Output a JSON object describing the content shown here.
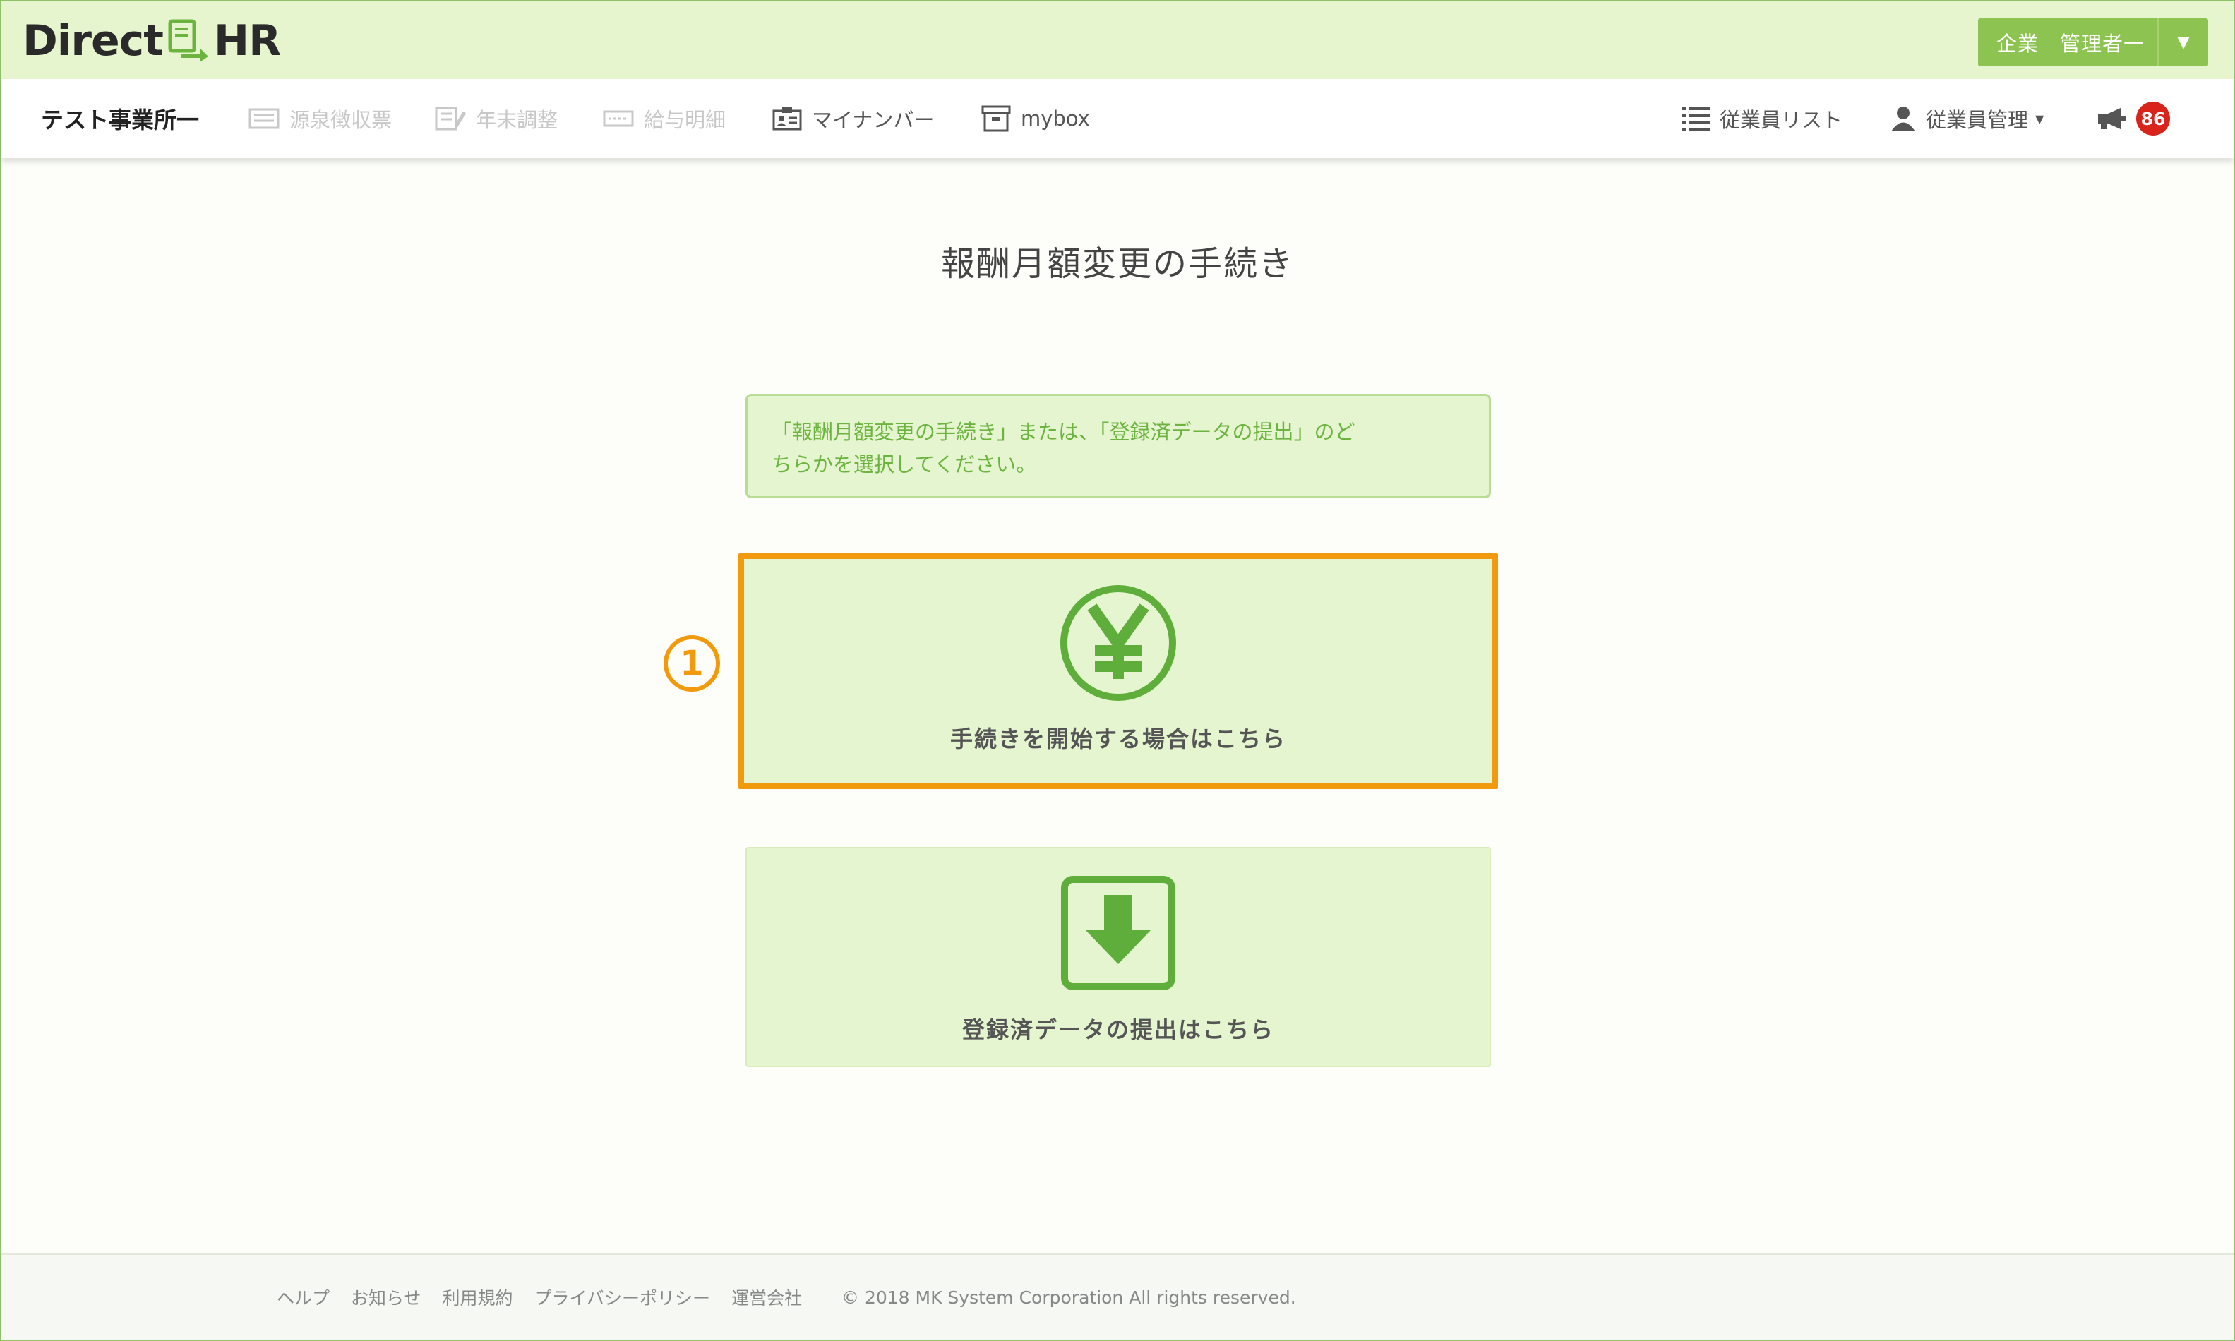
{
  "header": {
    "logo_left": "Direct",
    "logo_right": "HR",
    "admin_label": "企業　管理者一"
  },
  "nav": {
    "office_name": "テスト事業所一",
    "items": [
      {
        "label": "源泉徴収票",
        "icon": "receipt-icon",
        "enabled": false
      },
      {
        "label": "年末調整",
        "icon": "document-edit-icon",
        "enabled": false
      },
      {
        "label": "給与明細",
        "icon": "payslip-icon",
        "enabled": false
      },
      {
        "label": "マイナンバー",
        "icon": "id-card-icon",
        "enabled": true
      },
      {
        "label": "mybox",
        "icon": "box-icon",
        "enabled": true
      }
    ],
    "employee_list": "従業員リスト",
    "employee_manage": "従業員管理",
    "notification_count": "86"
  },
  "main": {
    "title": "報酬月額変更の手続き",
    "info_line1": "「報酬月額変更の手続き」または、「登録済データの提出」のど",
    "info_line2": "ちらかを選択してください。",
    "start_label": "手続きを開始する場合はこちら",
    "download_label": "登録済データの提出はこちら",
    "step_number": "1"
  },
  "footer": {
    "links": [
      "ヘルプ",
      "お知らせ",
      "利用規約",
      "プライバシーポリシー",
      "運営会社"
    ],
    "copyright": "© 2018 MK System Corporation All rights reserved."
  },
  "colors": {
    "header_bg": "#e7f5cf",
    "accent_green": "#6cb33f",
    "highlight_orange": "#f19a0e",
    "badge_red": "#d9241c"
  }
}
